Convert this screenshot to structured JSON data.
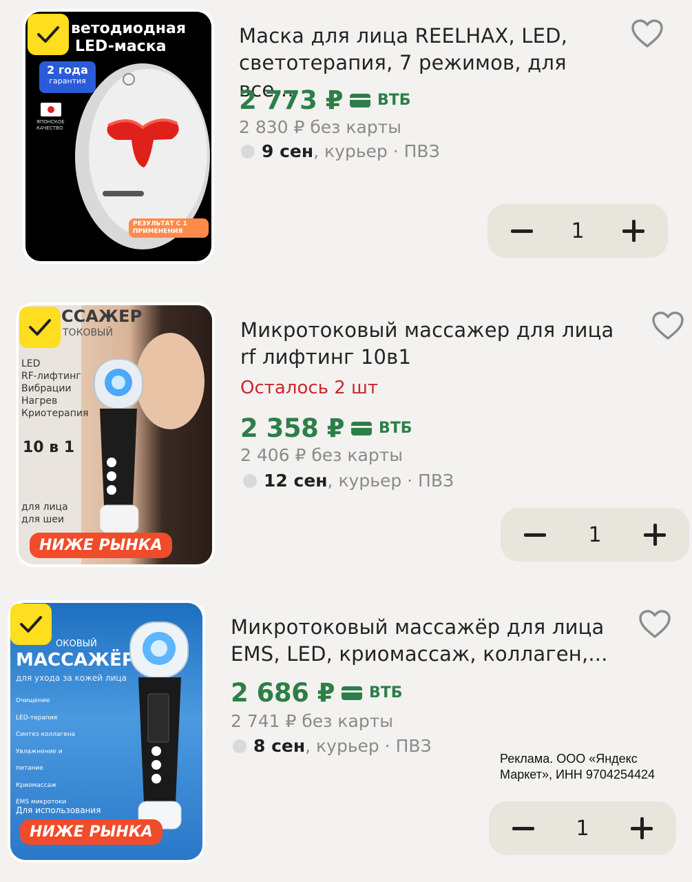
{
  "products": [
    {
      "title_line1": "Маска для лица REELHAX, LED,",
      "title_line2": "светотерапия, 7 режимов, для все...",
      "stock": "",
      "price": "2 773 ₽",
      "bank": "ВТБ",
      "old_price": "2 830 ₽  без карты",
      "delivery_date": "9 сен",
      "delivery_rest": ", курьер · ПВЗ",
      "qty": "1",
      "image": {
        "headline1": "ветодиодная",
        "headline2": "LED-маска",
        "badge1": "2 года",
        "badge2": "гарантия",
        "note": "ЯПОНСКОЕ КАЧЕСТВО",
        "result": "РЕЗУЛЬТАТ С 1 ПРИМЕНЕНИЯ"
      }
    },
    {
      "title_line1": "Микротоковый массажер для лица",
      "title_line2": "rf лифтинг 10в1",
      "stock": "Осталось 2 шт",
      "price": "2 358 ₽",
      "bank": "ВТБ",
      "old_price": "2 406 ₽  без карты",
      "delivery_date": "12 сен",
      "delivery_rest": ", курьер · ПВЗ",
      "qty": "1",
      "image": {
        "headline1": "ССАЖЕР",
        "headline2": "ТОКОВЫЙ",
        "features": [
          "LED",
          "RF-лифтинг",
          "Вибрации",
          "Нагрев",
          "Криотерапия"
        ],
        "badge": "10 в 1",
        "bottom1": "для лица",
        "bottom2": "для шеи",
        "promo": "НИЖЕ РЫНКА"
      }
    },
    {
      "title_line1": "Микротоковый массажёр для лица",
      "title_line2": "EMS, LED, криомассаж, коллаген,...",
      "stock": "",
      "price": "2 686 ₽",
      "bank": "ВТБ",
      "old_price": "2 741 ₽  без карты",
      "delivery_date": "8 сен",
      "delivery_rest": ", курьер · ПВЗ",
      "qty": "1",
      "image": {
        "headline1": "ОКОВЫЙ",
        "headline2": "МАССАЖЁР",
        "subtitle": "для ухода за кожей лица",
        "features": [
          "Очищение",
          "LED-терапия",
          "Синтез коллагена",
          "Увлажнение и питание",
          "Криомассаж",
          "EMS микротоки"
        ],
        "usage": "Для использования",
        "promo": "НИЖЕ РЫНКА"
      }
    }
  ],
  "ad_label": {
    "line1": "Реклама. ООО «Яндекс",
    "line2": "Маркет», ИНН 9704254424"
  },
  "colors": {
    "price_green": "#2c7f47",
    "check_yellow": "#ffdd1f",
    "stock_red": "#c8282c",
    "stepper_bg": "#e8e5dc"
  },
  "icons": [
    "check-icon",
    "heart-icon",
    "minus-icon",
    "plus-icon",
    "bank-card-icon",
    "dot-icon"
  ]
}
